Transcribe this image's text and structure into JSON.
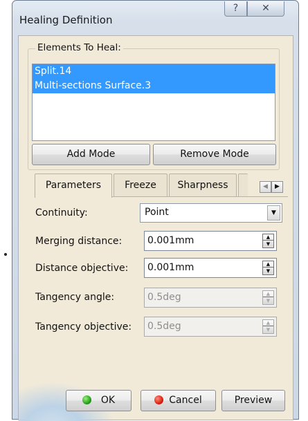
{
  "window": {
    "title": "Healing Definition",
    "help_glyph": "?",
    "close_glyph": "✕"
  },
  "elements_group": {
    "legend": "Elements To Heal:",
    "items": [
      "Split.14",
      "Multi-sections Surface.3"
    ],
    "add_mode": "Add Mode",
    "remove_mode": "Remove Mode"
  },
  "tabs": [
    {
      "label": "Parameters",
      "active": true
    },
    {
      "label": "Freeze",
      "active": false
    },
    {
      "label": "Sharpness",
      "active": false
    }
  ],
  "tab_scroll": {
    "left": "◀",
    "right": "▶"
  },
  "parameters": {
    "continuity": {
      "label": "Continuity:",
      "value": "Point",
      "arrow": "▼"
    },
    "merging_distance": {
      "label": "Merging distance:",
      "value": "0.001mm",
      "enabled": true
    },
    "distance_objective": {
      "label": "Distance objective:",
      "value": "0.001mm",
      "enabled": true
    },
    "tangency_angle": {
      "label": "Tangency angle:",
      "value": "0.5deg",
      "enabled": false
    },
    "tangency_objective": {
      "label": "Tangency objective:",
      "value": "0.5deg",
      "enabled": false
    }
  },
  "spin_glyphs": {
    "up": "▲",
    "down": "▼"
  },
  "buttons": {
    "ok": "OK",
    "cancel": "Cancel",
    "preview": "Preview"
  },
  "colors": {
    "selection": "#3399ff",
    "dialog_bg": "#f1ead9",
    "ok_icon": "#1e9b15",
    "cancel_icon": "#d81b0b"
  }
}
